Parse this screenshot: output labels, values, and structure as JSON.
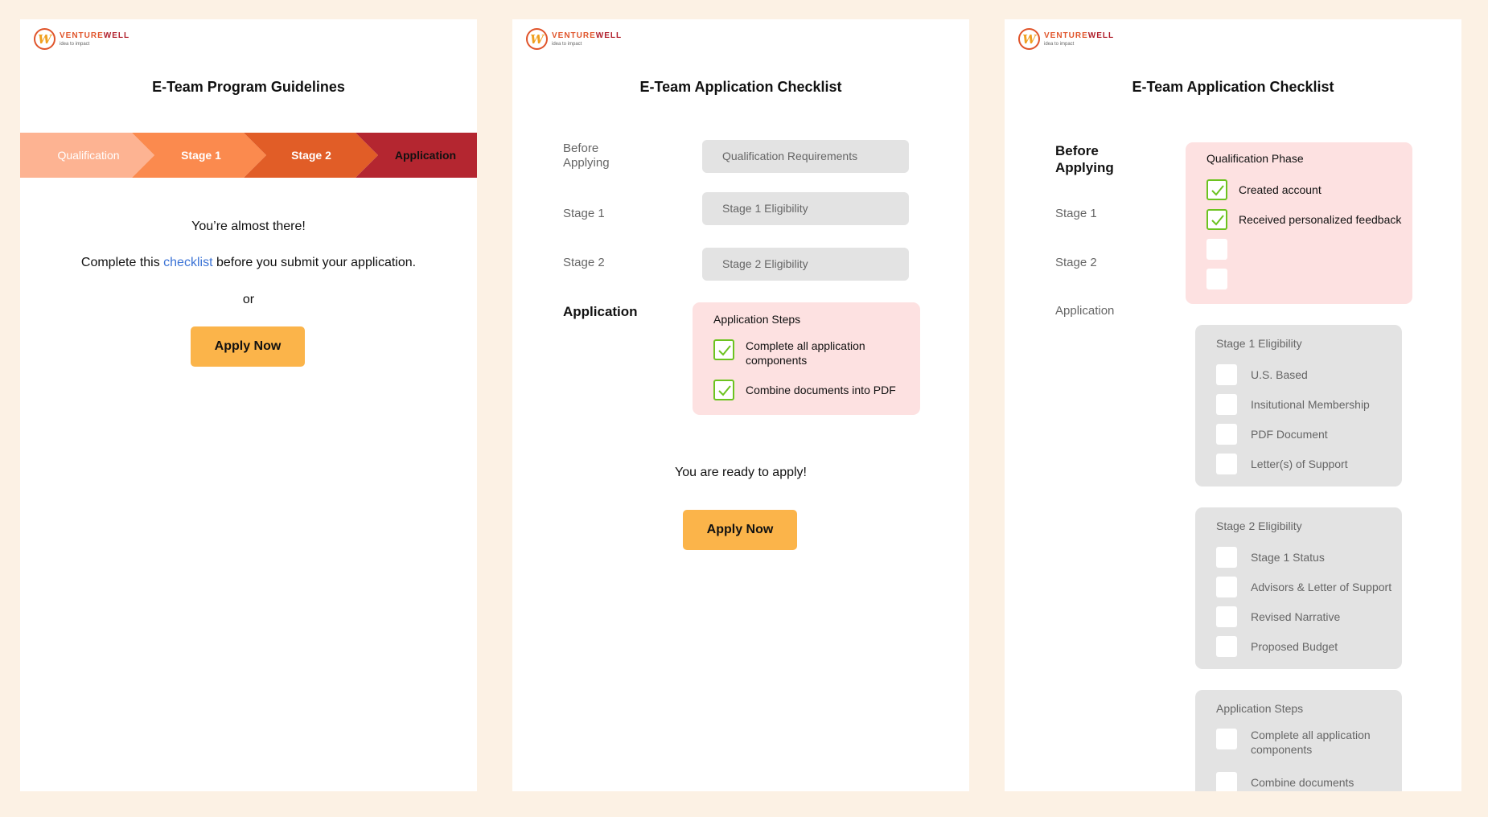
{
  "brand": {
    "name_part1": "VENTURE",
    "name_part2": "WELL",
    "tagline": "idea to impact",
    "mark": "W"
  },
  "colors": {
    "background": "#fcf1e4",
    "accent_orange": "#fbb44a",
    "check_green": "#6cc31f",
    "link_blue": "#3b73d6",
    "pink_box": "#fde1e1",
    "gray_box": "#e3e3e3"
  },
  "panel1": {
    "title": "E-Team Program Guidelines",
    "steps": [
      {
        "label": "Qualification",
        "color": "#fdb392",
        "text_color": "#ffffff"
      },
      {
        "label": "Stage 1",
        "color": "#fb8a4e",
        "text_color": "#ffffff"
      },
      {
        "label": "Stage 2",
        "color": "#e15d27",
        "text_color": "#ffffff"
      },
      {
        "label": "Application",
        "color": "#b42630",
        "text_color": "#111111"
      }
    ],
    "almost": "You’re almost there!",
    "checklist_pre": "Complete this ",
    "checklist_link": "checklist",
    "checklist_post": " before you submit your application.",
    "or": "or",
    "apply": "Apply Now"
  },
  "panel2": {
    "title": "E-Team Application Checklist",
    "rows": [
      {
        "label_line1": "Before",
        "label_line2": "Applying",
        "button": "Qualification Requirements"
      },
      {
        "label": "Stage 1",
        "button": "Stage 1 Eligibility"
      },
      {
        "label": "Stage 2",
        "button": "Stage 2 Eligibility"
      }
    ],
    "app_label": "Application",
    "box": {
      "heading": "Application Steps",
      "items": [
        {
          "line1": "Complete all application",
          "line2": "components",
          "checked": true
        },
        {
          "line1": "Combine documents into PDF",
          "checked": true
        }
      ]
    },
    "ready": "You are ready to apply!",
    "apply": "Apply Now"
  },
  "panel3": {
    "title": "E-Team Application Checklist",
    "labels": {
      "before_line1": "Before",
      "before_line2": "Applying",
      "stage1": "Stage 1",
      "stage2": "Stage 2",
      "application": "Application"
    },
    "qualification": {
      "heading": "Qualification Phase",
      "items": [
        {
          "label": "Created account",
          "checked": true
        },
        {
          "label": "Received personalized feedback",
          "checked": true
        },
        {
          "label": "",
          "checked": false
        },
        {
          "label": "",
          "checked": false
        }
      ]
    },
    "stage1": {
      "heading": "Stage 1 Eligibility",
      "items": [
        "U.S. Based",
        "Insitutional Membership",
        "PDF Document",
        "Letter(s) of Support"
      ]
    },
    "stage2": {
      "heading": "Stage 2 Eligibility",
      "items": [
        "Stage 1 Status",
        "Advisors & Letter of Support",
        "Revised Narrative",
        "Proposed Budget"
      ]
    },
    "appsteps": {
      "heading": "Application Steps",
      "items": [
        {
          "line1": "Complete all application",
          "line2": "components"
        },
        {
          "line1": "Combine documents"
        }
      ]
    }
  }
}
